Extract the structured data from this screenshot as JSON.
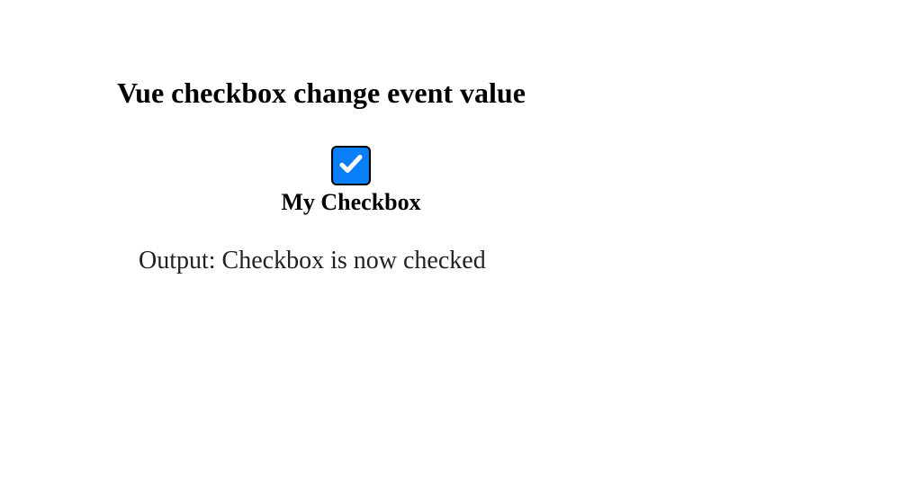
{
  "heading": "Vue checkbox change event value",
  "checkbox": {
    "label": "My Checkbox",
    "checked": true
  },
  "output": "Output: Checkbox is now checked"
}
